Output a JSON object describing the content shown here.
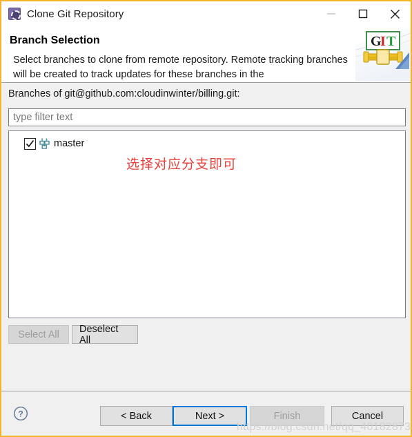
{
  "window": {
    "title": "Clone Git Repository",
    "icon": "eclipse-wizard-icon",
    "border_color": "#f5b32a",
    "controls": {
      "minimize_label": "minimize-icon",
      "maximize_label": "maximize-icon",
      "close_label": "close-icon"
    }
  },
  "header": {
    "title": "Branch Selection",
    "description": "Select branches to clone from remote repository. Remote tracking branches will be created to track updates for these branches in the",
    "logo": {
      "name": "git-logo",
      "text_g": "G",
      "text_i": "I",
      "text_t": "T",
      "color_g": "#1a1a1a",
      "color_i": "#d02020",
      "color_t": "#1f9d3a"
    }
  },
  "main": {
    "branches_label": "Branches of git@github.com:cloudinwinter/billing.git:",
    "filter": {
      "placeholder": "type filter text",
      "value": ""
    },
    "branches": [
      {
        "name": "master",
        "checked": true,
        "icon": "branch-icon"
      }
    ],
    "annotation": {
      "text": "选择对应分支即可",
      "color": "#e8403a"
    },
    "select_all_label": "Select All",
    "select_all_enabled": false,
    "deselect_all_label": "Deselect All",
    "deselect_all_enabled": true
  },
  "footer": {
    "help_label": "help-icon",
    "back_label": "< Back",
    "next_label": "Next >",
    "next_focused": true,
    "finish_label": "Finish",
    "finish_enabled": false,
    "cancel_label": "Cancel",
    "focus_color": "#0078d7"
  },
  "watermark": {
    "text": "https://blog.csdn.net/qq_40182873"
  }
}
